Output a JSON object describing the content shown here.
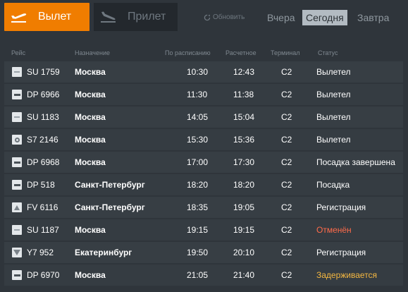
{
  "header": {
    "departures_label": "Вылет",
    "arrivals_label": "Прилет",
    "refresh_label": "Обновить",
    "days": {
      "yesterday": "Вчера",
      "today": "Сегодня",
      "tomorrow": "Завтра"
    }
  },
  "columns": {
    "flight": "Рейс",
    "destination": "Назначение",
    "scheduled": "По расписанию",
    "estimated": "Расчетное",
    "terminal": "Терминал",
    "status": "Статус"
  },
  "flights": [
    {
      "flight": "SU 1759",
      "destination": "Москва",
      "scheduled": "10:30",
      "estimated": "12:43",
      "terminal": "C2",
      "status": "Вылетел",
      "logo": "airline-logo-icon"
    },
    {
      "flight": "DP 6966",
      "destination": "Москва",
      "scheduled": "11:30",
      "estimated": "11:38",
      "terminal": "C2",
      "status": "Вылетел",
      "logo": "airline-logo-icon"
    },
    {
      "flight": "SU 1183",
      "destination": "Москва",
      "scheduled": "14:05",
      "estimated": "15:04",
      "terminal": "C2",
      "status": "Вылетел",
      "logo": "airline-logo-icon"
    },
    {
      "flight": "S7 2146",
      "destination": "Москва",
      "scheduled": "15:30",
      "estimated": "15:36",
      "terminal": "C2",
      "status": "Вылетел",
      "logo": "airline-logo-icon"
    },
    {
      "flight": "DP 6968",
      "destination": "Москва",
      "scheduled": "17:00",
      "estimated": "17:30",
      "terminal": "C2",
      "status": "Посадка завершена",
      "logo": "airline-logo-icon"
    },
    {
      "flight": "DP 518",
      "destination": "Санкт-Петербург",
      "scheduled": "18:20",
      "estimated": "18:20",
      "terminal": "C2",
      "status": "Посадка",
      "logo": "airline-logo-icon"
    },
    {
      "flight": "FV 6116",
      "destination": "Санкт-Петербург",
      "scheduled": "18:35",
      "estimated": "19:05",
      "terminal": "C2",
      "status": "Регистрация",
      "logo": "airline-logo-icon"
    },
    {
      "flight": "SU 1187",
      "destination": "Москва",
      "scheduled": "19:15",
      "estimated": "19:15",
      "terminal": "C2",
      "status": "Отменён",
      "logo": "airline-logo-icon"
    },
    {
      "flight": "Y7 952",
      "destination": "Екатеринбург",
      "scheduled": "19:50",
      "estimated": "20:10",
      "terminal": "C2",
      "status": "Регистрация",
      "logo": "airline-logo-icon"
    },
    {
      "flight": "DP 6970",
      "destination": "Москва",
      "scheduled": "21:05",
      "estimated": "21:40",
      "terminal": "C2",
      "status": "Задерживается",
      "logo": "airline-logo-icon"
    }
  ],
  "colors": {
    "accent": "#f07d00",
    "background": "#2f353b",
    "row": "#373e44",
    "cancelled": "#ff6b4a",
    "delayed": "#f5b841"
  }
}
